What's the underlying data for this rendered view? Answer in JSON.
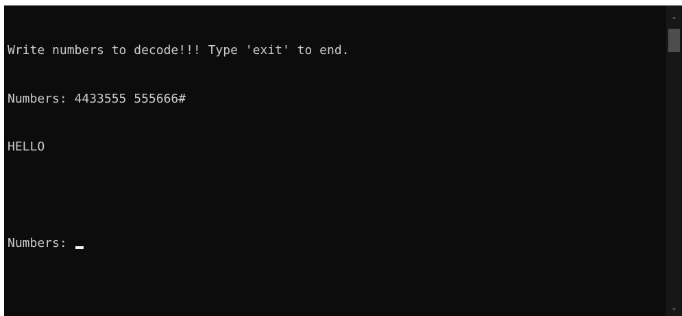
{
  "console": {
    "lines": [
      "Write numbers to decode!!! Type 'exit' to end.",
      "Numbers: 4433555 555666#",
      "HELLO",
      "",
      "Numbers: "
    ]
  },
  "scrollbar": {
    "up_icon": "chevron-up-icon",
    "down_icon": "chevron-down-icon",
    "up_glyph": "⌃",
    "down_glyph": "⌄"
  },
  "colors": {
    "background": "#0c0c0c",
    "text": "#cccccc",
    "cursor": "#f2f2f2"
  }
}
